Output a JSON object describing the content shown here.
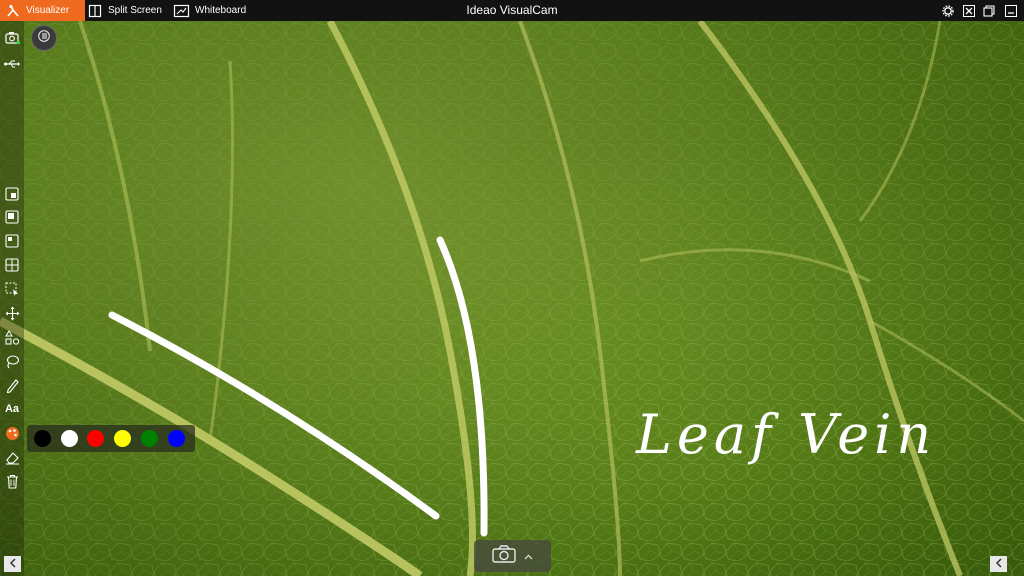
{
  "app": {
    "title": "Ideao VisualCam"
  },
  "tabs": [
    {
      "label": "Visualizer",
      "icon": "visualizer-icon",
      "active": true
    },
    {
      "label": "Split Screen",
      "icon": "split-screen-icon",
      "active": false
    },
    {
      "label": "Whiteboard",
      "icon": "whiteboard-icon",
      "active": false
    }
  ],
  "window_controls": [
    "settings-icon",
    "close-icon",
    "restore-icon",
    "minimize-icon"
  ],
  "toolbar": {
    "tools": [
      "camera-switch-icon",
      "usb-icon",
      "freeze-icon",
      "full-screen-icon",
      "half-screen-icon",
      "grid-icon",
      "selection-icon",
      "move-icon",
      "shapes-icon",
      "lasso-icon",
      "pen-icon",
      "text-icon",
      "color-icon",
      "eraser-icon",
      "delete-icon"
    ],
    "text_tool_label": "Aa"
  },
  "palette": {
    "colors": [
      "#000000",
      "#ffffff",
      "#ff0000",
      "#ffff00",
      "#008000",
      "#0000ff"
    ]
  },
  "annotation": {
    "text": "Leaf Vein"
  },
  "accent_color": "#ef6a1f"
}
